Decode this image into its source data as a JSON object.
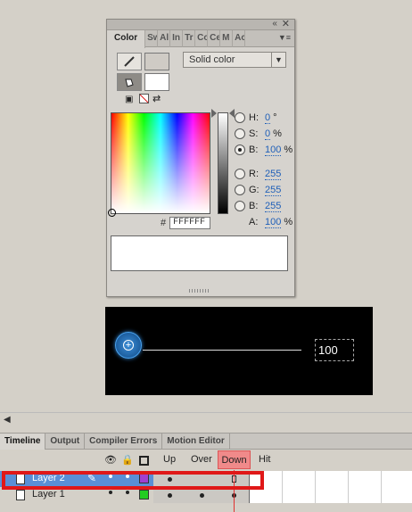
{
  "color_panel": {
    "tabs": [
      "Color",
      "Sw",
      "Al",
      "In",
      "Tr",
      "Co",
      "Ce",
      "M",
      "Ac"
    ],
    "fill_type": "Solid color",
    "hsb": [
      {
        "label": "H:",
        "value": "0",
        "unit": "°",
        "selected": false
      },
      {
        "label": "S:",
        "value": "0",
        "unit": "%",
        "selected": false
      },
      {
        "label": "B:",
        "value": "100",
        "unit": "%",
        "selected": true
      }
    ],
    "rgb": [
      {
        "label": "R:",
        "value": "255"
      },
      {
        "label": "G:",
        "value": "255"
      },
      {
        "label": "B:",
        "value": "255"
      }
    ],
    "alpha": {
      "label": "A:",
      "value": "100",
      "unit": "%"
    },
    "hex_label": "#",
    "hex_value": "FFFFFF",
    "stroke_color": "#cfcbc5",
    "fill_color": "#ffffff"
  },
  "stage": {
    "slider_value": "100"
  },
  "timeline": {
    "tabs": [
      "Timeline",
      "Output",
      "Compiler Errors",
      "Motion Editor"
    ],
    "frame_labels": [
      "Up",
      "Over",
      "Down",
      "Hit"
    ],
    "layers": [
      {
        "name": "Layer 2",
        "color": "#a040d0",
        "selected": true
      },
      {
        "name": "Layer 1",
        "color": "#22cc22",
        "selected": false
      }
    ]
  }
}
